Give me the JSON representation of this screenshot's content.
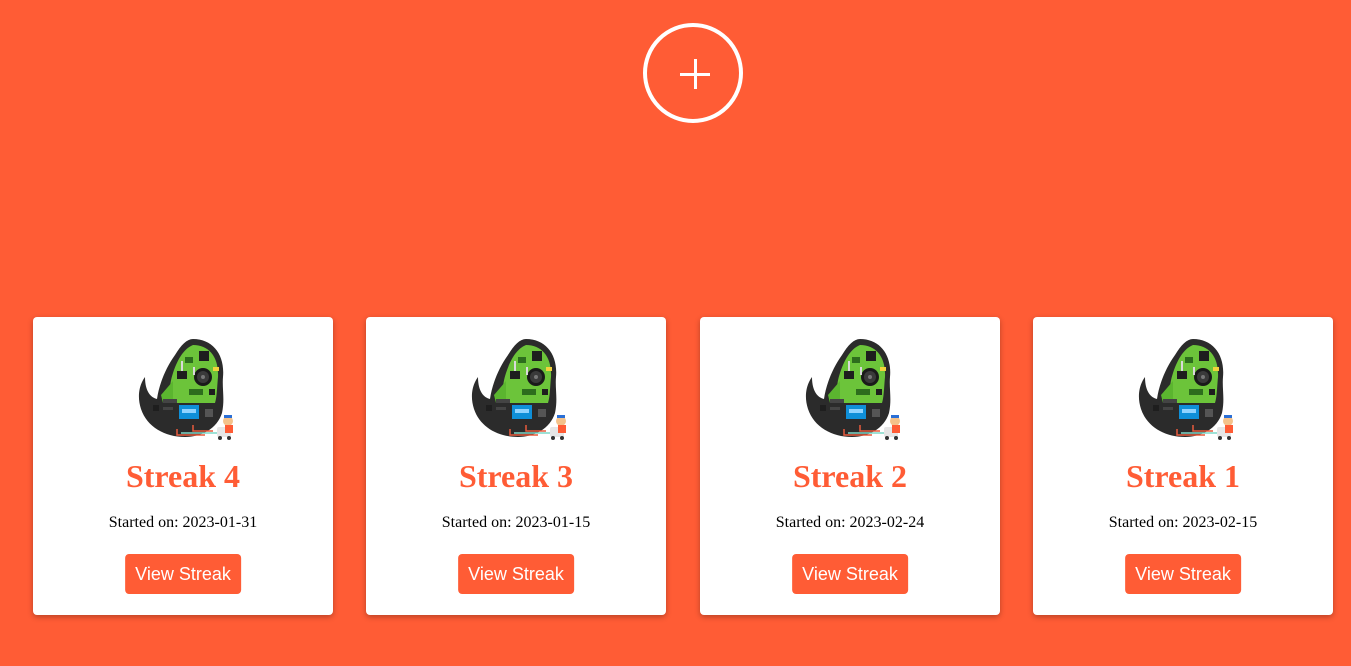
{
  "colors": {
    "background": "#ff5c35",
    "accent": "#ff5c35",
    "card_background": "#ffffff"
  },
  "header": {
    "add_icon": "plus-circle-icon"
  },
  "streaks": [
    {
      "title": "Streak 4",
      "started_label": "Started on:",
      "date": "2023-01-31",
      "button_label": "View Streak",
      "icon": "hackathon-circuit-logo"
    },
    {
      "title": "Streak 3",
      "started_label": "Started on:",
      "date": "2023-01-15",
      "button_label": "View Streak",
      "icon": "hackathon-circuit-logo"
    },
    {
      "title": "Streak 2",
      "started_label": "Started on:",
      "date": "2023-02-24",
      "button_label": "View Streak",
      "icon": "hackathon-circuit-logo"
    },
    {
      "title": "Streak 1",
      "started_label": "Started on:",
      "date": "2023-02-15",
      "button_label": "View Streak",
      "icon": "hackathon-circuit-logo"
    }
  ]
}
